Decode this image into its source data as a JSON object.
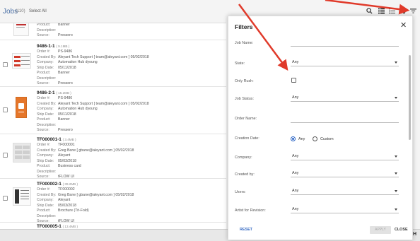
{
  "header": {
    "title": "Jobs",
    "count": "(110)",
    "select_all": "Select All"
  },
  "list": {
    "labels": {
      "order": "Order #:",
      "created": "Created By:",
      "company": "Company:",
      "ship": "Ship Date:",
      "product": "Product:",
      "description": "Description:",
      "source": "Source:"
    },
    "partial_top": {
      "product": "Banner",
      "source": "Pressero"
    },
    "items": [
      {
        "name": "9486-1-1",
        "size": "( 9.1MB )",
        "order": "PS-9486",
        "created": "Aleyant Tech Support [ team@aleyant.com ] 05/02/2018",
        "company": "Automation Hub dyoung",
        "ship": "05/11/2018",
        "product": "Banner",
        "description": "",
        "source": "Pressero"
      },
      {
        "name": "9486-2-1",
        "size": "( 15.2MB )",
        "order": "PS-9486",
        "created": "Aleyant Tech Support [ team@aleyant.com ] 05/02/2018",
        "company": "Automation Hub dyoung",
        "ship": "05/11/2018",
        "product": "Banner",
        "description": "",
        "source": "Pressero"
      },
      {
        "name": "TF000001-1",
        "size": "( 3.4MB )",
        "order": "TF000001",
        "created": "Greg Bane [ gbane@aleyant.com ] 05/02/2018",
        "company": "Aleyant",
        "ship": "05/03/2018",
        "product": "Business card",
        "description": "",
        "source": "tFLOW UI"
      },
      {
        "name": "TF000002-1",
        "size": "( 39.2MB )",
        "order": "TF000002",
        "created": "Greg Bane [ gbane@aleyant.com ] 05/02/2018",
        "company": "Aleyant",
        "ship": "05/03/2018",
        "product": "Brochure (Tri-Fold)",
        "description": "",
        "source": "tFLOW UI"
      },
      {
        "name": "TF000005-1",
        "size": "( 13.4MB )",
        "order": "",
        "created": "",
        "company": "",
        "ship": "",
        "product": "",
        "description": "",
        "source": ""
      }
    ]
  },
  "filters": {
    "title": "Filters",
    "close_symbol": "✕",
    "job_name_label": "Job Name:",
    "state_label": "State:",
    "state_value": "Any",
    "only_rush_label": "Only Rush:",
    "job_status_label": "Job Status:",
    "job_status_value": "Any",
    "order_name_label": "Order Name:",
    "creation_date_label": "Creation Date:",
    "creation_any": "Any",
    "creation_custom": "Custom",
    "company_label": "Company:",
    "company_value": "Any",
    "created_by_label": "Created by:",
    "created_by_value": "Any",
    "users_label": "Users:",
    "users_value": "Any",
    "artist_label": "Artist for Revision:",
    "artist_value": "Any",
    "reset": "RESET",
    "apply": "APPLY",
    "close": "CLOSE"
  },
  "footer": {
    "right_text": "H"
  },
  "colors": {
    "accent": "#2a64c5",
    "title_blue": "#4a6fa5",
    "arrow_red": "#e03a2a"
  }
}
